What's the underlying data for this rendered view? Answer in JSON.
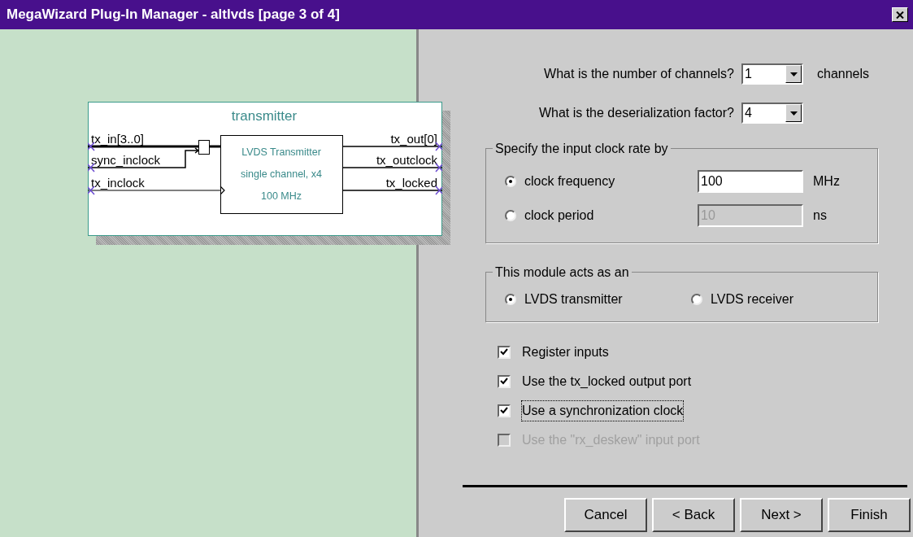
{
  "window": {
    "title": "MegaWizard Plug-In Manager - altlvds [page 3 of 4]"
  },
  "diagram": {
    "title": "transmitter",
    "inputs": [
      "tx_in[3..0]",
      "sync_inclock",
      "tx_inclock"
    ],
    "outputs": [
      "tx_out[0]",
      "tx_outclock",
      "tx_locked"
    ],
    "block_lines": [
      "LVDS Transmitter",
      "single channel, x4",
      "100 MHz"
    ]
  },
  "questions": [
    {
      "label": "What is the number of channels?",
      "value": "1",
      "unit": "channels"
    },
    {
      "label": "What is the deserialization factor?",
      "value": "4"
    }
  ],
  "clock_group": {
    "legend": "Specify the input clock rate by",
    "options": [
      {
        "label": "clock frequency",
        "selected": true,
        "value": "100",
        "unit": "MHz",
        "disabled": false
      },
      {
        "label": "clock period",
        "selected": false,
        "value": "10",
        "unit": "ns",
        "disabled": true
      }
    ]
  },
  "module_group": {
    "legend": "This module acts as an",
    "options": [
      {
        "label": "LVDS transmitter",
        "selected": true
      },
      {
        "label": "LVDS receiver",
        "selected": false
      }
    ]
  },
  "checkboxes": [
    {
      "label": "Register inputs",
      "checked": true,
      "disabled": false,
      "focused": false
    },
    {
      "label": "Use the tx_locked output port",
      "checked": true,
      "disabled": false,
      "focused": false
    },
    {
      "label": "Use a synchronization clock",
      "checked": true,
      "disabled": false,
      "focused": true
    },
    {
      "label": "Use the \"rx_deskew\" input port",
      "checked": false,
      "disabled": true,
      "focused": false
    }
  ],
  "buttons": [
    "Cancel",
    "< Back",
    "Next >",
    "Finish"
  ]
}
